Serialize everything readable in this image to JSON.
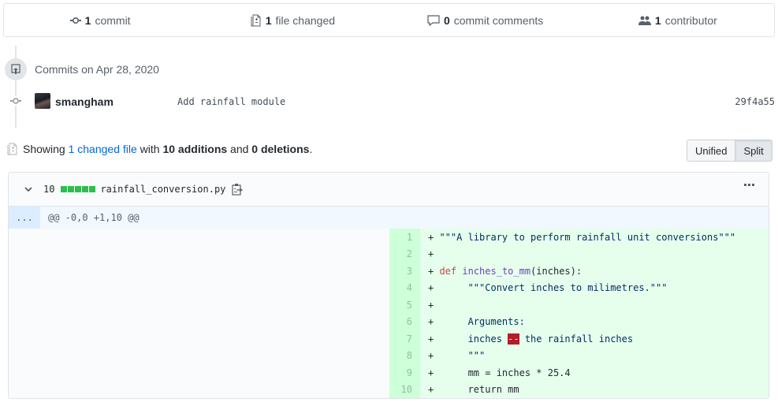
{
  "summary": {
    "commits": {
      "count": "1",
      "label": "commit",
      "icon": "git-commit-icon"
    },
    "files_changed": {
      "count": "1",
      "label": "file changed",
      "icon": "file-diff-icon"
    },
    "comments": {
      "count": "0",
      "label": "commit comments",
      "icon": "comment-icon"
    },
    "contributors": {
      "count": "1",
      "label": "contributor",
      "icon": "people-icon"
    }
  },
  "timeline": {
    "date_label": "Commits on Apr 28, 2020",
    "commit": {
      "author": "smangham",
      "message": "Add rainfall module",
      "sha": "29f4a55"
    }
  },
  "diff_summary": {
    "prefix": "Showing",
    "changed_files_link": "1 changed file",
    "with": "with",
    "additions": "10 additions",
    "and": "and",
    "deletions": "0 deletions",
    "suffix": "."
  },
  "view_toggle": {
    "unified_label": "Unified",
    "split_label": "Split",
    "selected": "Split"
  },
  "file": {
    "diffstat_count": "10",
    "diffstat_blocks": [
      "added",
      "added",
      "added",
      "added",
      "added"
    ],
    "name": "rainfall_conversion.py",
    "hunk_expand_label": "...",
    "hunk_header": "@@ -0,0 +1,10 @@",
    "colors": {
      "addition_bg": "#e6ffed",
      "addition_num_bg": "#cdffd8",
      "diffstat_green": "#2cbe4e",
      "link": "#0366d6"
    },
    "lines": [
      {
        "num": "1",
        "marker": "+",
        "indent": " ",
        "parts": [
          {
            "t": "\"\"\"A library to perform rainfall unit conversions\"\"\"",
            "c": "str"
          }
        ]
      },
      {
        "num": "2",
        "marker": "+",
        "indent": "",
        "parts": []
      },
      {
        "num": "3",
        "marker": "+",
        "indent": " ",
        "parts": [
          {
            "t": "def",
            "c": "kw"
          },
          {
            "t": " ",
            "c": ""
          },
          {
            "t": "inches_to_mm",
            "c": "fn"
          },
          {
            "t": "(inches):",
            "c": ""
          }
        ]
      },
      {
        "num": "4",
        "marker": "+",
        "indent": "      ",
        "parts": [
          {
            "t": "\"\"\"Convert inches to milimetres.\"\"\"",
            "c": "str"
          }
        ]
      },
      {
        "num": "5",
        "marker": "+",
        "indent": "",
        "parts": []
      },
      {
        "num": "6",
        "marker": "+",
        "indent": "      ",
        "parts": [
          {
            "t": "Arguments:",
            "c": "str"
          }
        ]
      },
      {
        "num": "7",
        "marker": "+",
        "indent": "      ",
        "parts": [
          {
            "t": "inches ",
            "c": "str"
          },
          {
            "t": "--",
            "c": "err"
          },
          {
            "t": " the rainfall inches",
            "c": "str"
          }
        ]
      },
      {
        "num": "8",
        "marker": "+",
        "indent": "      ",
        "parts": [
          {
            "t": "\"\"\"",
            "c": "str"
          }
        ]
      },
      {
        "num": "9",
        "marker": "+",
        "indent": "      ",
        "parts": [
          {
            "t": "mm = inches * 25.4",
            "c": ""
          }
        ]
      },
      {
        "num": "10",
        "marker": "+",
        "indent": "      ",
        "parts": [
          {
            "t": "return mm",
            "c": ""
          }
        ]
      }
    ]
  }
}
